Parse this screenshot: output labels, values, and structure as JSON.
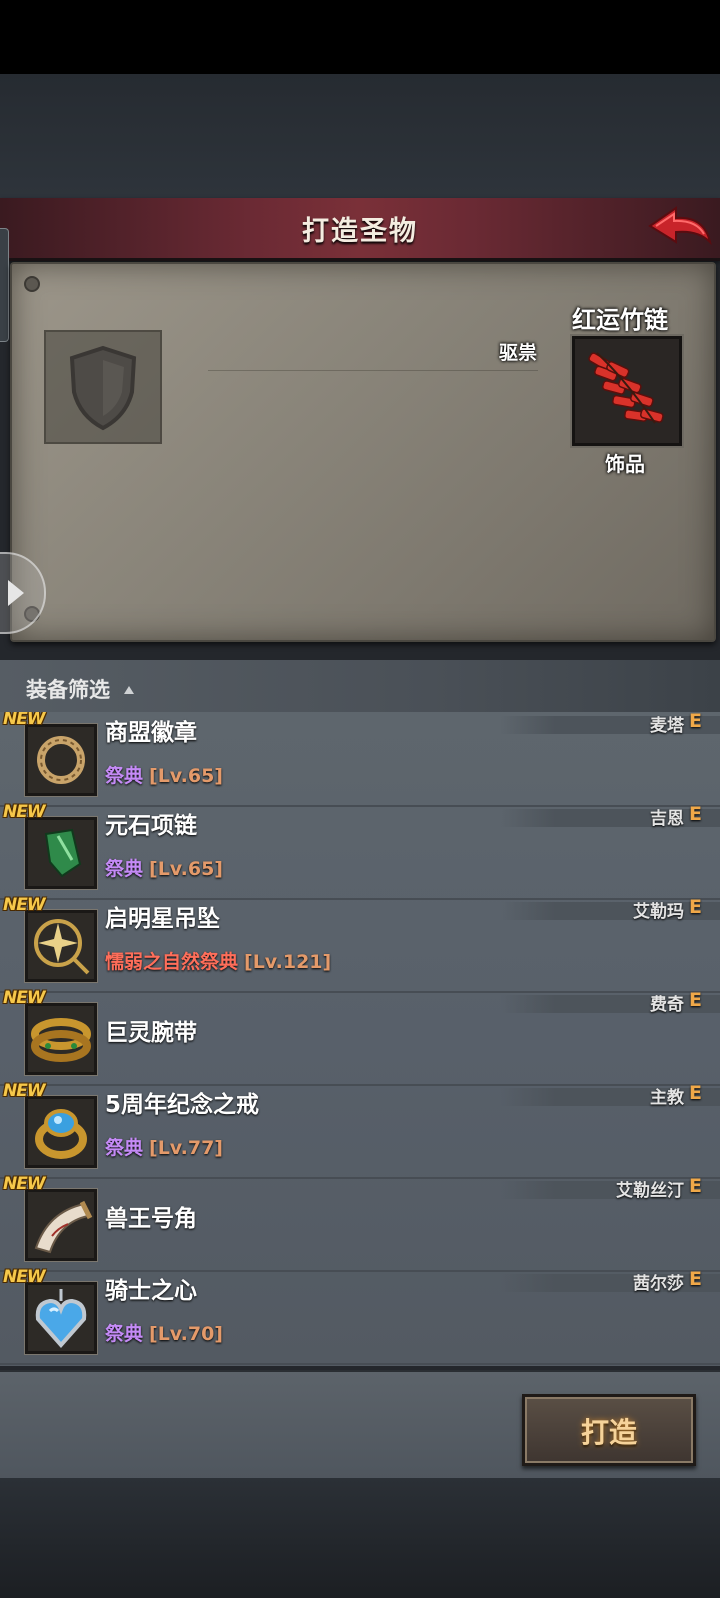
{
  "header": {
    "title": "打造圣物"
  },
  "selected_item": {
    "name": "红运竹链",
    "tag": "驱祟",
    "type": "饰品"
  },
  "filter": {
    "label": "装备筛选"
  },
  "new_badge": "NEW",
  "items": [
    {
      "name": "商盟徽章",
      "hero": "麦塔",
      "grade": "E",
      "req": "祭典",
      "level": "[Lv.65]",
      "req_color": "purple",
      "icon": "ring-coil-icon"
    },
    {
      "name": "元石项链",
      "hero": "吉恩",
      "grade": "E",
      "req": "祭典",
      "level": "[Lv.65]",
      "req_color": "purple",
      "icon": "green-crystal-necklace-icon"
    },
    {
      "name": "启明星吊坠",
      "hero": "艾勒玛",
      "grade": "E",
      "req": "懦弱之自然祭典",
      "level": "[Lv.121]",
      "req_color": "red",
      "icon": "compass-star-pendant-icon"
    },
    {
      "name": "巨灵腕带",
      "hero": "费奇",
      "grade": "E",
      "req": "",
      "level": "",
      "req_color": "none",
      "icon": "gold-bracelet-icon"
    },
    {
      "name": "5周年纪念之戒",
      "hero": "主教",
      "grade": "E",
      "req": "祭典",
      "level": "[Lv.77]",
      "req_color": "purple",
      "icon": "blue-gem-ring-icon"
    },
    {
      "name": "兽王号角",
      "hero": "艾勒丝汀",
      "grade": "E",
      "req": "",
      "level": "",
      "req_color": "none",
      "icon": "horn-icon"
    },
    {
      "name": "骑士之心",
      "hero": "茜尔莎",
      "grade": "E",
      "req": "祭典",
      "level": "[Lv.70]",
      "req_color": "purple",
      "icon": "heart-pendant-icon"
    }
  ],
  "footer": {
    "craft_label": "打造"
  },
  "colors": {
    "header": "#6b2a34",
    "grade": "#f0a848",
    "new": "#f6c84a",
    "purple_req": "#c48af6",
    "red_req": "#ff6e5a"
  }
}
